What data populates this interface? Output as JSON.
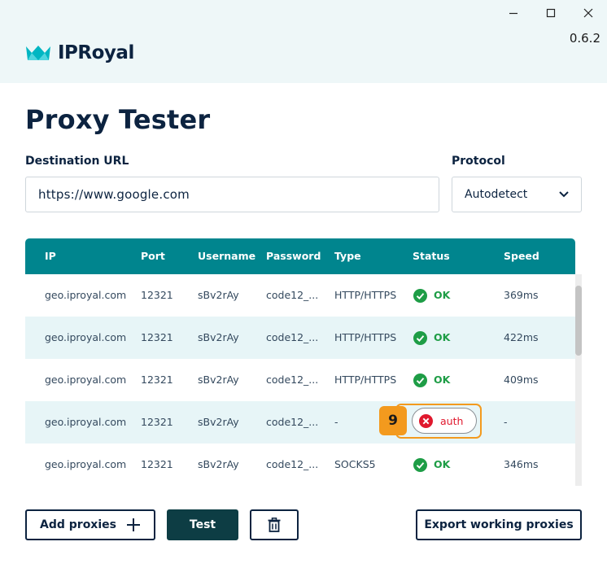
{
  "window": {
    "version": "0.6.2",
    "controls": {
      "minimize": "minimize",
      "maximize": "maximize",
      "close": "close"
    }
  },
  "brand": {
    "logo_text": "IPRoyal",
    "accent": "#00b6c2"
  },
  "page": {
    "title": "Proxy Tester"
  },
  "form": {
    "url_label": "Destination URL",
    "url_value": "https://www.google.com",
    "protocol_label": "Protocol",
    "protocol_value": "Autodetect"
  },
  "table": {
    "columns": [
      "IP",
      "Port",
      "Username",
      "Password",
      "Type",
      "Status",
      "Speed"
    ],
    "rows": [
      {
        "ip": "geo.iproyal.com",
        "port": "12321",
        "username": "sBv2rAy",
        "password": "code12_...",
        "type": "HTTP/HTTPS",
        "status": "OK",
        "speed": "369ms"
      },
      {
        "ip": "geo.iproyal.com",
        "port": "12321",
        "username": "sBv2rAy",
        "password": "code12_...",
        "type": "HTTP/HTTPS",
        "status": "OK",
        "speed": "422ms"
      },
      {
        "ip": "geo.iproyal.com",
        "port": "12321",
        "username": "sBv2rAy",
        "password": "code12_...",
        "type": "HTTP/HTTPS",
        "status": "OK",
        "speed": "409ms"
      },
      {
        "ip": "geo.iproyal.com",
        "port": "12321",
        "username": "sBv2rAy",
        "password": "code12_...",
        "type": "-",
        "status": "auth",
        "speed": "-"
      },
      {
        "ip": "geo.iproyal.com",
        "port": "12321",
        "username": "sBv2rAy",
        "password": "code12_...",
        "type": "SOCKS5",
        "status": "OK",
        "speed": "346ms"
      }
    ],
    "highlight_badge": "9"
  },
  "actions": {
    "add_proxies": "Add proxies",
    "test": "Test",
    "export": "Export working proxies",
    "delete_icon": "trash-icon"
  },
  "colors": {
    "header_teal": "#00858e",
    "ok_green": "#1e9d46",
    "error_red": "#e0182d",
    "highlight_orange": "#f39a1e",
    "dark_button": "#0d3d44"
  }
}
